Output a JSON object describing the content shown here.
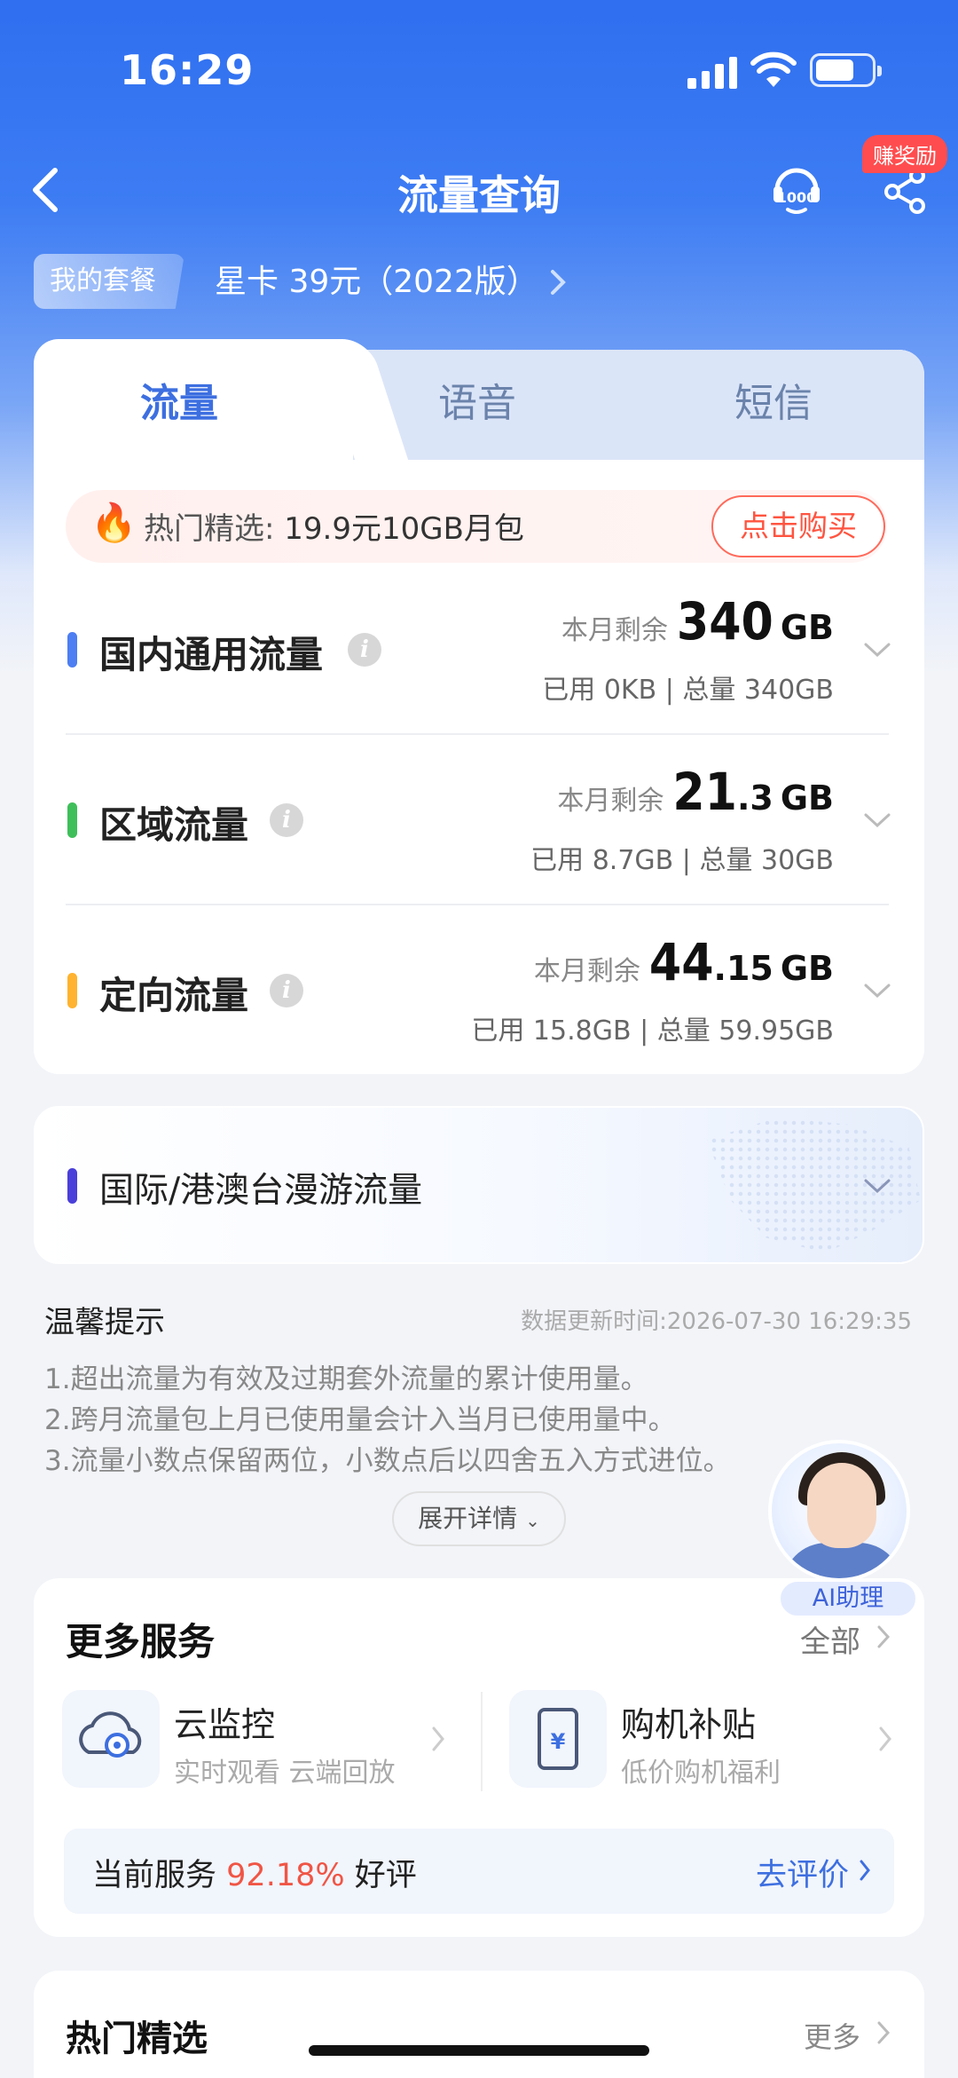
{
  "status_bar": {
    "time": "16:29"
  },
  "header": {
    "title": "流量查询",
    "reward_badge": "赚奖励"
  },
  "plan": {
    "tag": "我的套餐",
    "name": "星卡 39元（2022版）"
  },
  "tabs": [
    {
      "label": "流量",
      "active": true
    },
    {
      "label": "语音",
      "active": false
    },
    {
      "label": "短信",
      "active": false
    }
  ],
  "promo": {
    "label": "热门精选:",
    "text": "19.9元10GB月包",
    "button": "点击购买"
  },
  "usage_rows": [
    {
      "title": "国内通用流量",
      "remain_label": "本月剩余",
      "remain_int": "340",
      "remain_dec": "",
      "unit": "GB",
      "used_label": "已用",
      "used": "0KB",
      "total_label": "总量",
      "total": "340GB",
      "color": "#4d7ef2"
    },
    {
      "title": "区域流量",
      "remain_label": "本月剩余",
      "remain_int": "21",
      "remain_dec": ".3",
      "unit": "GB",
      "used_label": "已用",
      "used": "8.7GB",
      "total_label": "总量",
      "total": "30GB",
      "color": "#3fbf5a"
    },
    {
      "title": "定向流量",
      "remain_label": "本月剩余",
      "remain_int": "44",
      "remain_dec": ".15",
      "unit": "GB",
      "used_label": "已用",
      "used": "15.8GB",
      "total_label": "总量",
      "total": "59.95GB",
      "color": "#ffb330"
    }
  ],
  "roaming": {
    "title": "国际/港澳台漫游流量",
    "color": "#4a3fd9"
  },
  "tips": {
    "title": "温馨提示",
    "update_time": "数据更新时间:2026-07-30 16:29:35",
    "items": [
      "1.超出流量为有效及过期套外流量的累计使用量。",
      "2.跨月流量包上月已使用量会计入当月已使用量中。",
      "3.流量小数点保留两位，小数点后以四舍五入方式进位。"
    ],
    "expand": "展开详情"
  },
  "ai_assistant": {
    "label": "AI助理"
  },
  "services": {
    "title": "更多服务",
    "all": "全部",
    "items": [
      {
        "name": "云监控",
        "sub": "实时观看 云端回放",
        "icon": "cloud-camera-icon"
      },
      {
        "name": "购机补贴",
        "sub": "低价购机福利",
        "icon": "phone-subsidy-icon"
      }
    ],
    "rating_prefix": "当前服务",
    "rating_pct": "92.18%",
    "rating_suffix": "好评",
    "rate_button": "去评价"
  },
  "hot": {
    "title": "热门精选",
    "more": "更多"
  }
}
